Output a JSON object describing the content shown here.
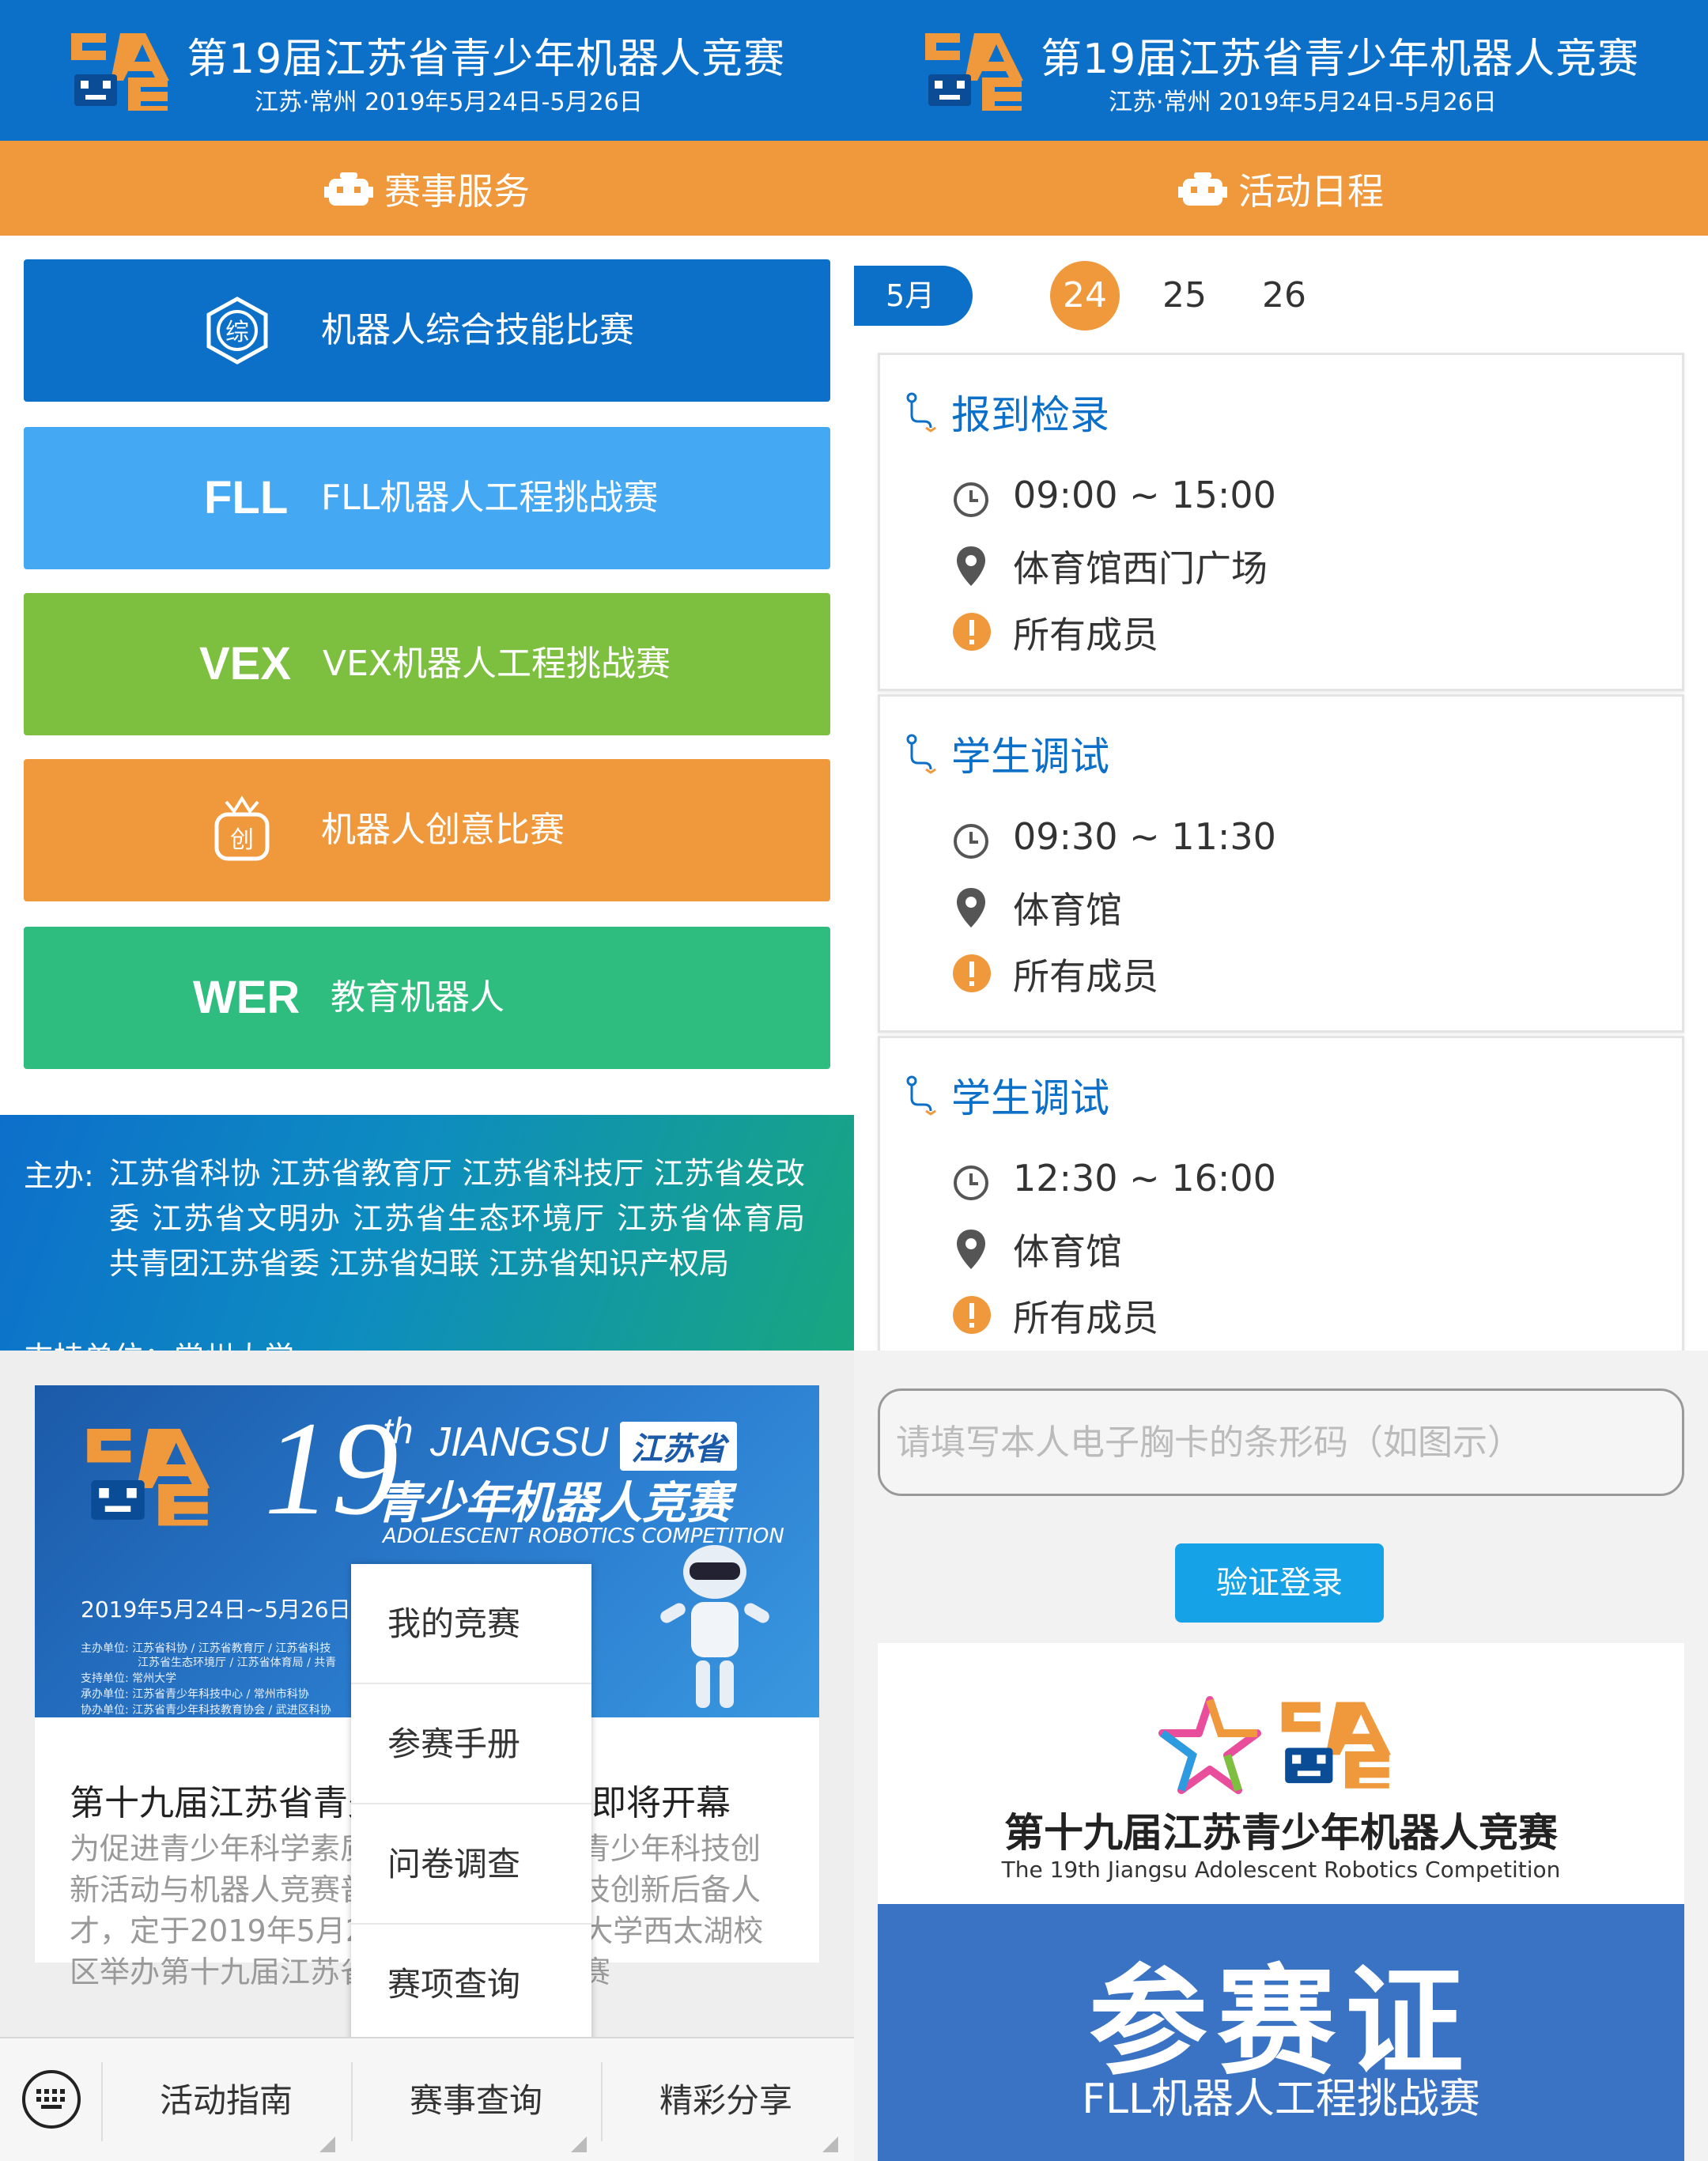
{
  "header": {
    "title": "第19届江苏省青少年机器人竞赛",
    "subtitle": "江苏·常州  2019年5月24日-5月26日"
  },
  "services": {
    "section_title": "赛事服务",
    "items": [
      {
        "code": "",
        "label": "机器人综合技能比赛",
        "color": "#0c6fc8",
        "icon": "zong-icon",
        "icon_text": "综"
      },
      {
        "code": "FLL",
        "label": "FLL机器人工程挑战赛",
        "color": "#44a8f3"
      },
      {
        "code": "VEX",
        "label": "VEX机器人工程挑战赛",
        "color": "#7dbf3f"
      },
      {
        "code": "",
        "label": "机器人创意比赛",
        "color": "#f0983c",
        "icon": "chuang-icon",
        "icon_text": "创"
      },
      {
        "code": "WER",
        "label": "教育机器人",
        "color": "#2fbd7f"
      }
    ],
    "sponsor_label": "主办:",
    "sponsor_text": "江苏省科协    江苏省教育厅    江苏省科技厅    江苏省发改委    江苏省文明办    江苏省生态环境厅    江苏省体育局    共青团江苏省委    江苏省妇联    江苏省知识产权局",
    "support_label": "支持单位：常州大学"
  },
  "schedule": {
    "section_title": "活动日程",
    "month_tab": "5月",
    "days": [
      "24",
      "25",
      "26"
    ],
    "active_day": "24",
    "events": [
      {
        "title": "报到检录",
        "time": "09:00 ~ 15:00",
        "place": "体育馆西门广场",
        "who": "所有成员"
      },
      {
        "title": "学生调试",
        "time": "09:30 ~ 11:30",
        "place": "体育馆",
        "who": "所有成员"
      },
      {
        "title": "学生调试",
        "time": "12:30 ~ 16:00",
        "place": "体育馆",
        "who": "所有成员"
      }
    ]
  },
  "article": {
    "banner": {
      "num": "19",
      "th": "th",
      "jiangsu_en": "JIANGSU",
      "jiangsu_cn": "江苏省",
      "title_cn": "青少年机器人竞赛",
      "title_en": "ADOLESCENT ROBOTICS COMPETITION",
      "date": "2019年5月24日~5月26日",
      "fine_lines": [
        "主办单位: 江苏省科协 / 江苏省教育厅 / 江苏省科技",
        "江苏省生态环境厅 / 江苏省体育局 / 共青",
        "支持单位: 常州大学",
        "承办单位: 江苏省青少年科技中心 / 常州市科协",
        "协办单位: 江苏省青少年科技教育协会 / 武进区科协"
      ]
    },
    "title": "第十九届江苏省青少年机器人竞赛即将开幕",
    "body": "为促进青少年科学素质提升，推动我省青少年科技创新活动与机器人竞赛普及发展，培养科技创新后备人才，定于2019年5月24日-26日在常州大学西太湖校区举办第十九届江苏省青少年机器人竞赛",
    "popup_menu": [
      "我的竞赛",
      "参赛手册",
      "问卷调查",
      "赛项查询"
    ],
    "bottom_menu": [
      "活动指南",
      "赛事查询",
      "精彩分享"
    ]
  },
  "login": {
    "placeholder": "请填写本人电子胸卡的条形码（如图示）",
    "button": "验证登录",
    "badge_title": "第十九届江苏青少年机器人竞赛",
    "badge_en": "The 19th Jiangsu Adolescent Robotics Competition",
    "badge_cert": "参赛证",
    "badge_sub": "FLL机器人工程挑战赛"
  },
  "colors": {
    "brand_blue": "#0c6fc8",
    "accent_orange": "#f0983c",
    "link_blue": "#16a2e6"
  }
}
